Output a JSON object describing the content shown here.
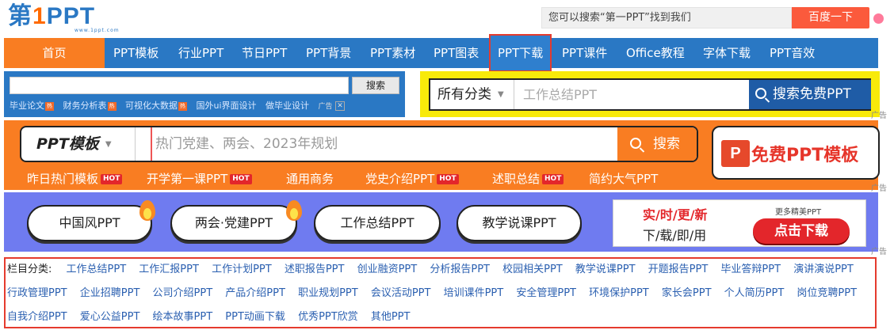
{
  "logo": {
    "main_prefix": "第",
    "main_num": "1",
    "main_suffix": "PPT",
    "url": "www.1ppt.com"
  },
  "top_search": {
    "placeholder": "您可以搜索“第一PPT”找到我们",
    "button": "百度一下"
  },
  "nav": {
    "home": "首页",
    "items": [
      "PPT模板",
      "行业PPT",
      "节日PPT",
      "PPT背景",
      "PPT素材",
      "PPT图表",
      "PPT下载",
      "PPT课件",
      "Office教程",
      "字体下载",
      "PPT音效"
    ]
  },
  "mini_search": {
    "button": "搜索",
    "links": [
      "毕业论文",
      "财务分析表",
      "可视化大数据",
      "国外ui界面设计",
      "做毕业设计"
    ],
    "ad": "广告",
    "close": "✕"
  },
  "category_search": {
    "select": "所有分类",
    "placeholder": "工作总结PPT",
    "button": "搜索免费PPT",
    "ad": "广告"
  },
  "template_search": {
    "select": "PPT模板",
    "placeholder": "热门党建、两会、2023年规划",
    "button": "搜索",
    "free_ico": "P",
    "free_label": "免费PPT模板",
    "ad": "广告"
  },
  "hot_tags": [
    {
      "label": "昨日热门模板",
      "hot": "HOT"
    },
    {
      "label": "开学第一课PPT",
      "hot": "HOT"
    },
    {
      "label": "通用商务",
      "hot": ""
    },
    {
      "label": "党史介绍PPT",
      "hot": "HOT"
    },
    {
      "label": "述职总结",
      "hot": "HOT"
    },
    {
      "label": "简约大气PPT",
      "hot": ""
    }
  ],
  "pills": [
    "中国风PPT",
    "两会·党建PPT",
    "工作总结PPT",
    "教学说课PPT"
  ],
  "download_ad": {
    "line1": "实/时/更/新",
    "line2": "下/载/即/用",
    "more": "更多精美PPT",
    "button": "点击下载",
    "ad": "广告"
  },
  "categories": {
    "label": "栏目分类:",
    "row1": [
      "工作总结PPT",
      "工作汇报PPT",
      "工作计划PPT",
      "述职报告PPT",
      "创业融资PPT",
      "分析报告PPT",
      "校园相关PPT",
      "教学说课PPT",
      "开题报告PPT",
      "毕业答辩PPT",
      "演讲演说PPT"
    ],
    "row2": [
      "行政管理PPT",
      "企业招聘PPT",
      "公司介绍PPT",
      "产品介绍PPT",
      "职业规划PPT",
      "会议活动PPT",
      "培训课件PPT",
      "安全管理PPT",
      "环境保护PPT",
      "家长会PPT",
      "个人简历PPT",
      "岗位竞聘PPT"
    ],
    "row3": [
      "自我介绍PPT",
      "爱心公益PPT",
      "绘本故事PPT",
      "PPT动画下载",
      "优秀PPT欣赏",
      "其他PPT"
    ]
  },
  "colors": {
    "nav_blue": "#2a78c4",
    "orange": "#f97d22",
    "yellow": "#f8ea0a",
    "purple": "#6f7bf0",
    "red": "#e3262b"
  }
}
